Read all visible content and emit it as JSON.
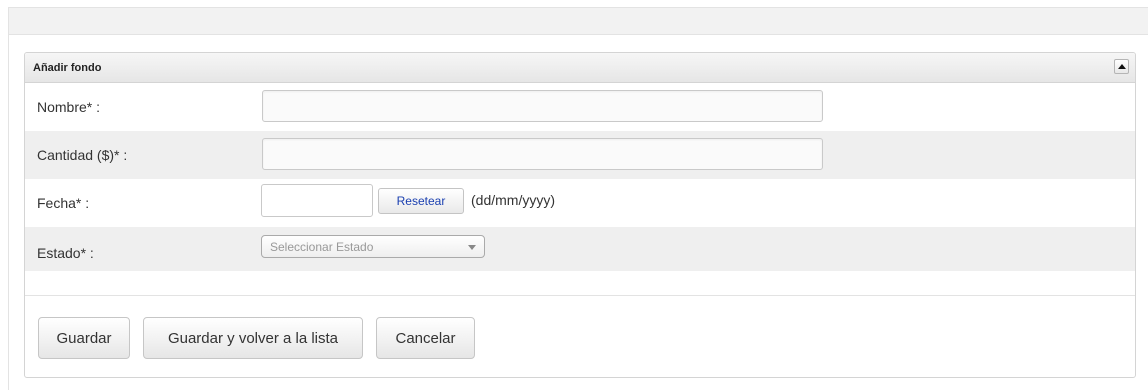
{
  "panel": {
    "title": "Añadir fondo"
  },
  "form": {
    "nombre_label": "Nombre* :",
    "nombre_value": "",
    "cantidad_label": "Cantidad ($)* :",
    "cantidad_value": "",
    "fecha_label": "Fecha* :",
    "fecha_value": "",
    "reset_label": "Resetear",
    "date_format_hint": "(dd/mm/yyyy)",
    "estado_label": "Estado* :",
    "estado_selected": "Seleccionar Estado"
  },
  "actions": {
    "save_label": "Guardar",
    "save_back_label": "Guardar y volver a la lista",
    "cancel_label": "Cancelar"
  },
  "icons": {
    "collapse": "triangle-up-icon",
    "dropdown": "chevron-down-icon"
  },
  "colors": {
    "link_blue": "#1a3fb0",
    "alt_row": "#efefef"
  }
}
